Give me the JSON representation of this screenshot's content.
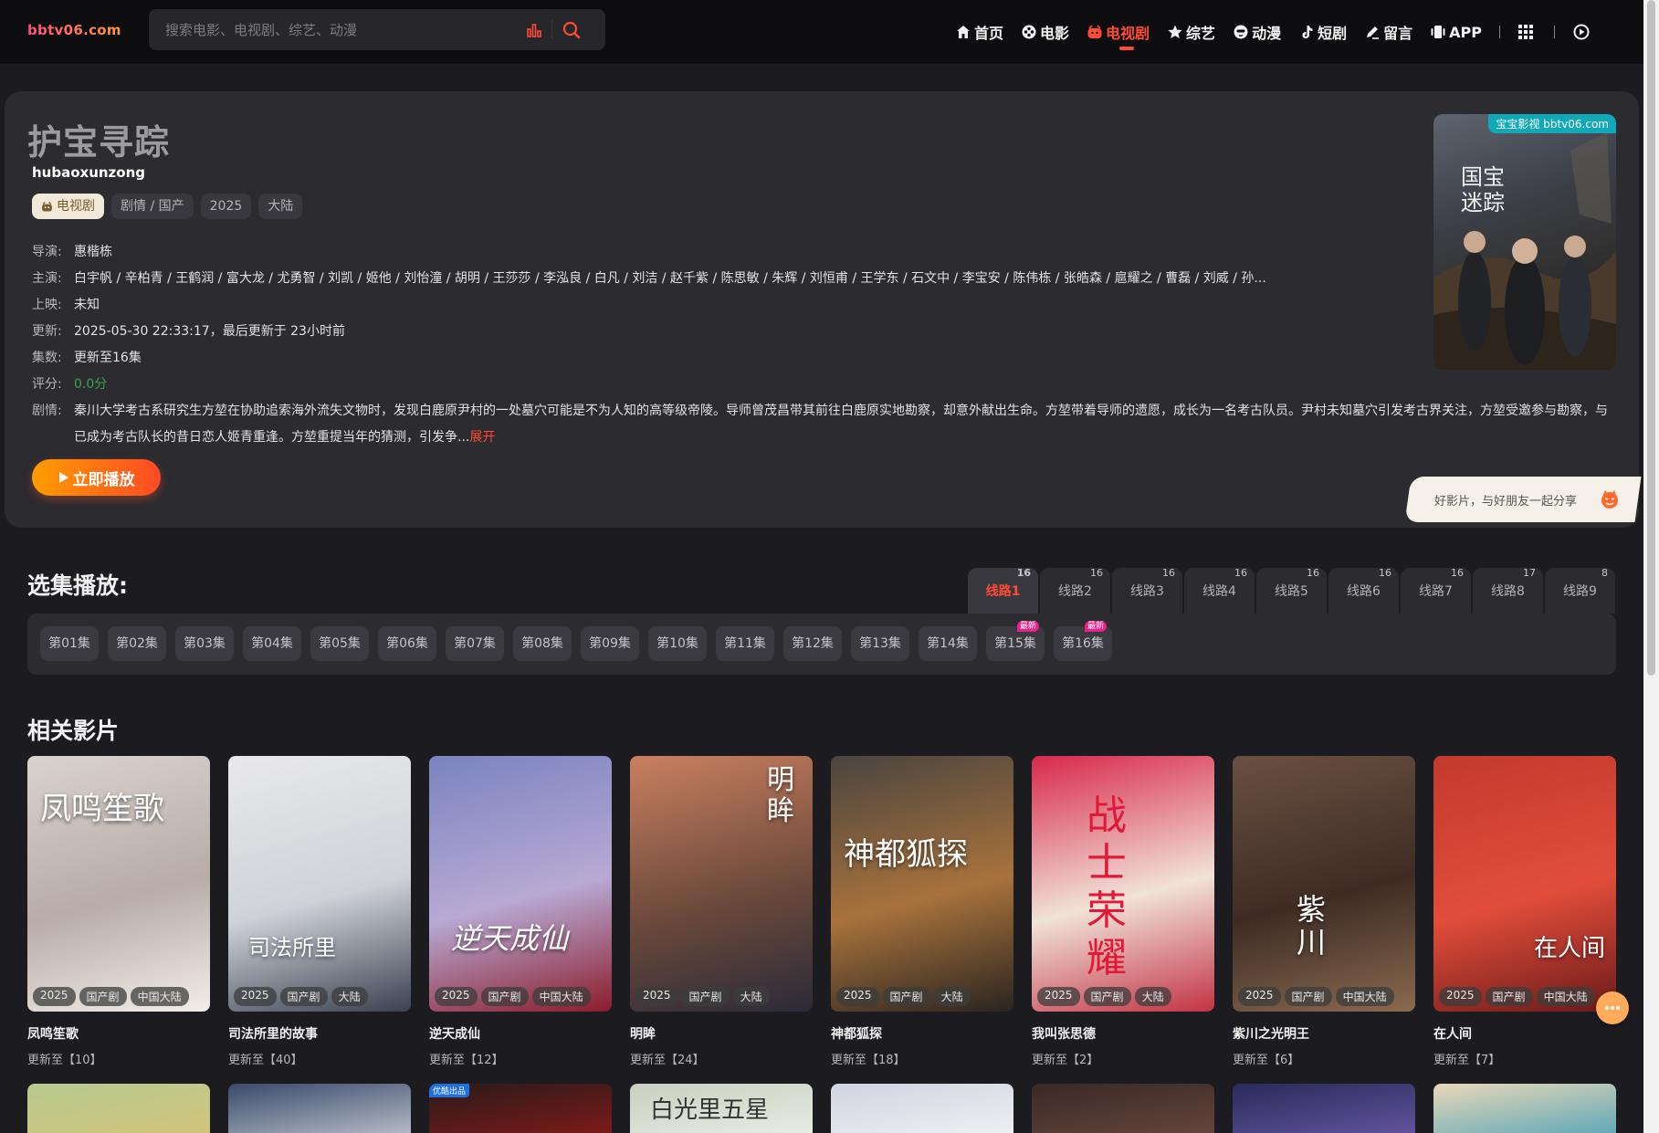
{
  "site": {
    "logo": "bbtv06.com"
  },
  "search": {
    "placeholder": "搜索电影、电视剧、综艺、动漫"
  },
  "nav": {
    "items": [
      {
        "label": "首页",
        "icon": "home-icon"
      },
      {
        "label": "电影",
        "icon": "film-reel-icon"
      },
      {
        "label": "电视剧",
        "icon": "tv-icon",
        "active": true
      },
      {
        "label": "综艺",
        "icon": "star-icon"
      },
      {
        "label": "动漫",
        "icon": "anime-face-icon"
      },
      {
        "label": "短剧",
        "icon": "tiktok-icon"
      },
      {
        "label": "留言",
        "icon": "pen-icon"
      },
      {
        "label": "APP",
        "icon": "app-icon"
      }
    ]
  },
  "detail": {
    "title": "护宝寻踪",
    "pinyin": "hubaoxunzong",
    "type_tag": "电视剧",
    "tags": [
      "剧情 / 国产",
      "2025",
      "大陆"
    ],
    "director_label": "导演:",
    "director": "惠楷栋",
    "cast_label": "主演:",
    "cast": "白宇帆 / 辛柏青 / 王鹤润 / 富大龙 / 尤勇智 / 刘凯 / 姬他 / 刘怡潼 / 胡明 / 王莎莎 / 李泓良 / 白凡 / 刘洁 / 赵千紫 / 陈思敏 / 朱辉 / 刘恒甫 / 王学东 / 石文中 / 李宝安 / 陈伟栋 / 张皓森 / 扈耀之 / 曹磊 / 刘威 / 孙...",
    "release_label": "上映:",
    "release": "未知",
    "updated_label": "更新:",
    "updated": "2025-05-30 22:33:17，最后更新于 23小时前",
    "episodes_label": "集数:",
    "episodes": "更新至16集",
    "score_label": "评分:",
    "score": "0.0分",
    "plot_label": "剧情:",
    "plot": "秦川大学考古系研究生方堃在协助追索海外流失文物时，发现白鹿原尹村的一处墓穴可能是不为人知的高等级帝陵。导师曾茂昌带其前往白鹿原实地勘察，却意外献出生命。方堃带着导师的遗愿，成长为一名考古队员。尹村未知墓穴引发考古界关注，方堃受邀参与勘察，与已成为考古队长的昔日恋人姬青重逢。方堃重提当年的猜测，引发争...",
    "plot_more": "展开",
    "play_label": "立即播放",
    "poster_badge": "宝宝影视 bbtv06.com",
    "poster_title": "国宝迷踪",
    "share_text": "好影片，与好朋友一起分享"
  },
  "episodes_section": {
    "title": "选集播放:",
    "lines": [
      {
        "label": "线路1",
        "count": "16",
        "active": true
      },
      {
        "label": "线路2",
        "count": "16"
      },
      {
        "label": "线路3",
        "count": "16"
      },
      {
        "label": "线路4",
        "count": "16"
      },
      {
        "label": "线路5",
        "count": "16"
      },
      {
        "label": "线路6",
        "count": "16"
      },
      {
        "label": "线路7",
        "count": "16"
      },
      {
        "label": "线路8",
        "count": "17"
      },
      {
        "label": "线路9",
        "count": "8"
      }
    ],
    "episodes": [
      "第01集",
      "第02集",
      "第03集",
      "第04集",
      "第05集",
      "第06集",
      "第07集",
      "第08集",
      "第09集",
      "第10集",
      "第11集",
      "第12集",
      "第13集",
      "第14集",
      "第15集",
      "第16集"
    ],
    "new_badge": "最新",
    "new_episodes": [
      "第15集",
      "第16集"
    ]
  },
  "related": {
    "title": "相关影片",
    "items": [
      {
        "name": "凤鸣笙歌",
        "update": "更新至【10】",
        "meta": [
          "2025",
          "国产剧",
          "中国大陆"
        ],
        "poster_text": "凤鸣笙歌",
        "colors": [
          "#d9d3cf",
          "#b9aca6",
          "#f2ede9"
        ]
      },
      {
        "name": "司法所里的故事",
        "update": "更新至【40】",
        "meta": [
          "2025",
          "国产剧",
          "大陆"
        ],
        "poster_text": "司法所里",
        "colors": [
          "#e9e9ec",
          "#cfd2d8",
          "#3a4150"
        ]
      },
      {
        "name": "逆天成仙",
        "update": "更新至【12】",
        "meta": [
          "2025",
          "国产剧",
          "中国大陆"
        ],
        "poster_text": "逆天成仙",
        "colors": [
          "#7a83c0",
          "#b8a9d4",
          "#8b1c2b"
        ]
      },
      {
        "name": "明眸",
        "update": "更新至【24】",
        "meta": [
          "2025",
          "国产剧",
          "大陆"
        ],
        "poster_text": "明眸",
        "colors": [
          "#c98060",
          "#6e4a3c",
          "#2b2a38"
        ]
      },
      {
        "name": "神都狐探",
        "update": "更新至【18】",
        "meta": [
          "2025",
          "国产剧",
          "大陆"
        ],
        "poster_text": "神都狐探",
        "colors": [
          "#4a4440",
          "#a8723c",
          "#2a2420"
        ]
      },
      {
        "name": "我叫张思德",
        "update": "更新至【2】",
        "meta": [
          "2025",
          "国产剧",
          "大陆"
        ],
        "poster_text": "战士荣耀",
        "colors": [
          "#d8284a",
          "#f1e2d8",
          "#c23345"
        ]
      },
      {
        "name": "紫川之光明王",
        "update": "更新至【6】",
        "meta": [
          "2025",
          "国产剧",
          "中国大陆"
        ],
        "poster_text": "紫川",
        "colors": [
          "#6a5042",
          "#3e2c24",
          "#8a6a50"
        ]
      },
      {
        "name": "在人间",
        "update": "更新至【7】",
        "meta": [
          "2025",
          "国产剧",
          "中国大陆"
        ],
        "poster_text": "在人间",
        "colors": [
          "#c23a2e",
          "#e24d3a",
          "#6a1a1a"
        ]
      }
    ],
    "row2_colors": [
      [
        "#b7c98e",
        "#d6c47a"
      ],
      [
        "#3a4a6a",
        "#c8ccd6"
      ],
      [
        "#2a1a1a",
        "#8a1a1a"
      ],
      [
        "#c8d0c0",
        "#eef0e8"
      ],
      [
        "#d0d4e0",
        "#f4f4f6"
      ],
      [
        "#3a2826",
        "#6a4a40"
      ],
      [
        "#2a2a5a",
        "#6a5aa8"
      ],
      [
        "#e8d8b8",
        "#4aa0b8"
      ]
    ],
    "row2_badge": "优酷出品",
    "row2_text": "白光里五星"
  },
  "colors": {
    "accent": "#ff4b33",
    "bg": "#1c1c20",
    "card": "#2b2b30"
  }
}
